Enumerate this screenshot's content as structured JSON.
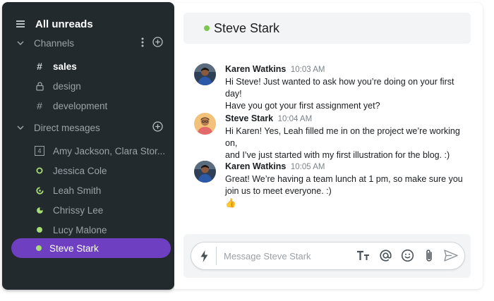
{
  "sidebar": {
    "title": "All unreads",
    "channels": {
      "label": "Channels",
      "items": [
        {
          "name": "sales",
          "icon": "hash-icon",
          "unread": true
        },
        {
          "name": "design",
          "icon": "lock-icon",
          "unread": false
        },
        {
          "name": "development",
          "icon": "hash-icon",
          "unread": false
        }
      ]
    },
    "direct_messages": {
      "label": "Direct mesages",
      "items": [
        {
          "name": "Amy Jackson, Clara Stor...",
          "icon": "group-count-icon",
          "badge": "4"
        },
        {
          "name": "Jessica Cole",
          "icon": "status-ring-icon"
        },
        {
          "name": "Leah Smith",
          "icon": "status-partial-icon"
        },
        {
          "name": "Chrissy Lee",
          "icon": "status-pie-icon"
        },
        {
          "name": "Lucy Malone",
          "icon": "status-online-icon"
        },
        {
          "name": "Steve Stark",
          "icon": "status-online-icon",
          "active": true
        }
      ]
    }
  },
  "chat": {
    "title": "Steve Stark",
    "messages": [
      {
        "author": "Karen Watkins",
        "time": "10:03 AM",
        "lines": [
          "Hi Steve! Just wanted to ask how you’re doing on your first day!",
          "Have you got your first assignment yet?"
        ]
      },
      {
        "author": "Steve Stark",
        "time": "10:04 AM",
        "lines": [
          "Hi Karen! Yes, Leah filled me in on the project we’re working on,",
          "and I’ve just started with my first illustration for the blog. :)"
        ]
      },
      {
        "author": "Karen Watkins",
        "time": "10:05 AM",
        "lines": [
          "Great! We’re having a team lunch at 1 pm, so make sure you",
          "join us to meet everyone.  :)",
          "👍"
        ]
      }
    ],
    "composer": {
      "placeholder": "Message Steve Stark",
      "value": ""
    }
  },
  "colors": {
    "sidebar_bg": "#222a2e",
    "active_item": "#6e3fc0",
    "online": "#a6dd74",
    "header_status": "#7cc54e"
  }
}
